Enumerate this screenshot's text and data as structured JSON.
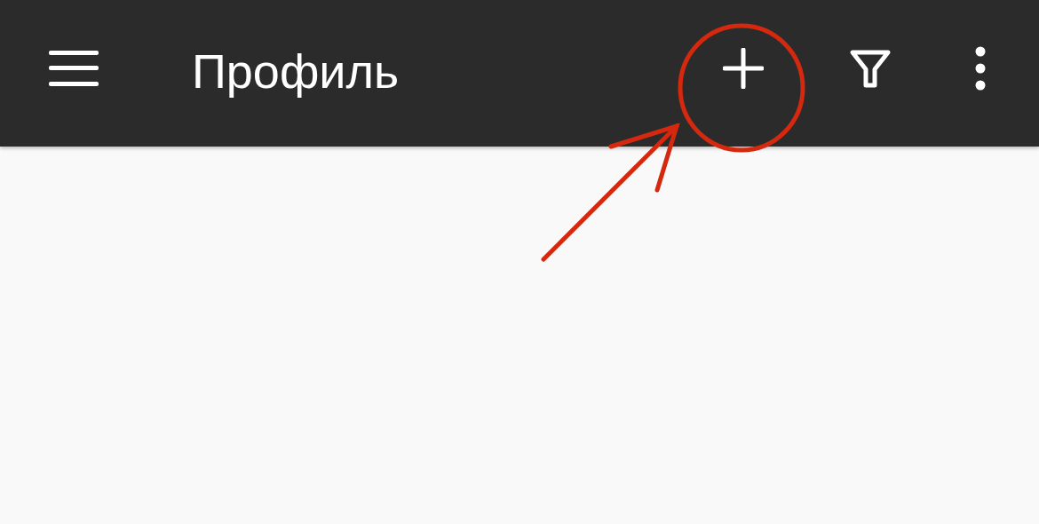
{
  "toolbar": {
    "title": "Профиль",
    "actions": [
      {
        "kind": "add"
      },
      {
        "kind": "filter"
      },
      {
        "kind": "more"
      }
    ]
  }
}
